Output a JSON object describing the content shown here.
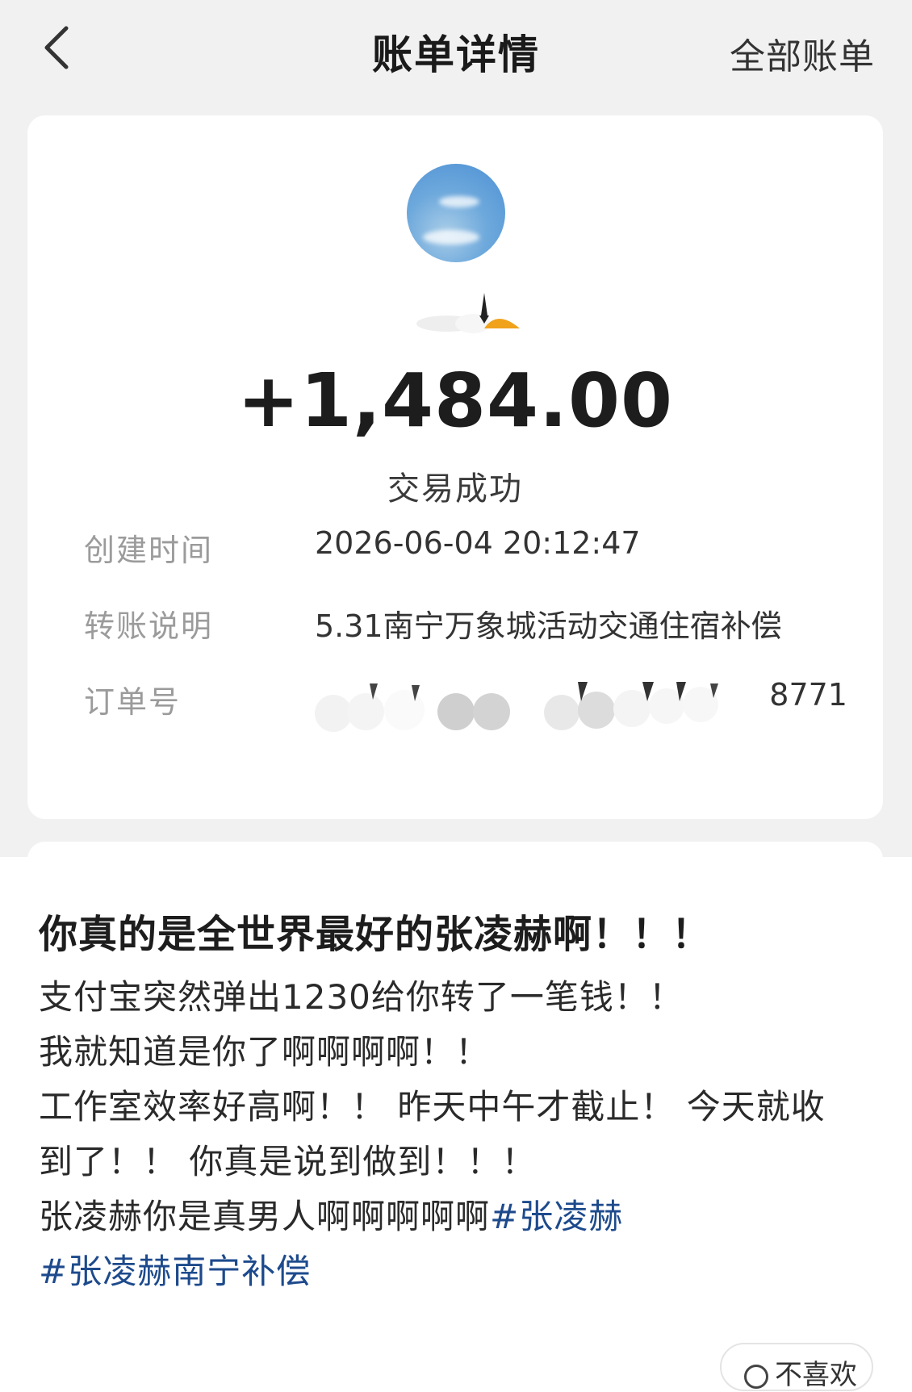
{
  "nav": {
    "back_icon": "chevron-left-icon",
    "title": "账单详情",
    "right_link": "全部账单"
  },
  "bill": {
    "amount": "+1,484.00",
    "status": "交易成功",
    "rows": [
      {
        "label": "创建时间",
        "value": "2026-06-04 20:12:47"
      },
      {
        "label": "转账说明",
        "value": "5.31南宁万象城活动交通住宿补偿"
      },
      {
        "label": "订单号",
        "value": "8771"
      }
    ]
  },
  "post": {
    "title": "你真的是全世界最好的张凌赫啊！！！",
    "lines": [
      "支付宝突然弹出1230给你转了一笔钱！！",
      "我就知道是你了啊啊啊啊！！",
      "工作室效率好高啊！！ 昨天中午才截止！ 今天就收",
      "到了！！ 你真是说到做到！！！",
      "张凌赫你是真男人啊啊啊啊啊"
    ],
    "tag1": "#张凌赫",
    "tag2": "#张凌赫南宁补偿",
    "dislike_label": "不喜欢"
  },
  "colors": {
    "page_bg": "#f1f1f1",
    "card_bg": "#ffffff",
    "topic_link": "#1d4a8c",
    "label_gray": "#9b9b9b"
  }
}
